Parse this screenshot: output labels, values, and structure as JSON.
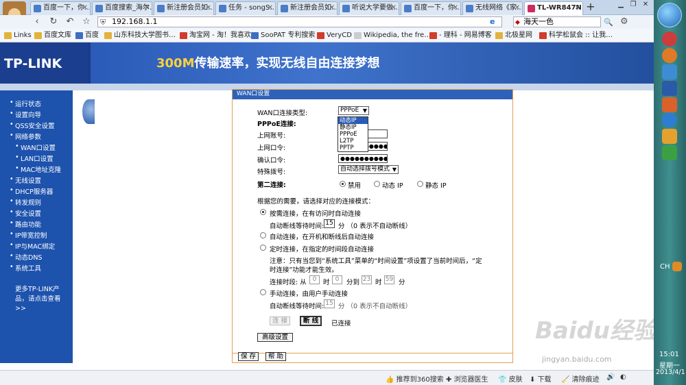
{
  "browser": {
    "tabs": [
      {
        "label": "百度一下，你…"
      },
      {
        "label": "百度搜索_海尔…"
      },
      {
        "label": "新注册会员如…"
      },
      {
        "label": "任务 - songS…"
      },
      {
        "label": "新注册会员如…"
      },
      {
        "label": "听说大学要做…"
      },
      {
        "label": "百度一下，你…"
      },
      {
        "label": "无线网络《家…"
      },
      {
        "label": "TL-WR847N"
      }
    ],
    "new_tab": "+",
    "url": "192.168.1.1",
    "search_value": "海天一色",
    "bookmarks": [
      "Links",
      "百度文库",
      "百度",
      "山东科技大学图书…",
      "淘宝网 - 淘！我喜欢",
      "SooPAT 专利搜索",
      "VeryCD",
      "Wikipedia, the fre…",
      "- 理科 - 网易博客",
      "北极星网",
      "科学松鼠会 :: 让我…"
    ]
  },
  "router": {
    "brand": "TP-LINK",
    "slogan_highlight": "300M",
    "slogan_rest": "传输速率，实现无线自由连接梦想",
    "menu": [
      {
        "label": "运行状态"
      },
      {
        "label": "设置向导"
      },
      {
        "label": "QSS安全设置"
      },
      {
        "label": "网络参数"
      },
      {
        "label": "WAN口设置"
      },
      {
        "label": "LAN口设置"
      },
      {
        "label": "MAC地址克隆"
      },
      {
        "label": "无线设置"
      },
      {
        "label": "DHCP服务器"
      },
      {
        "label": "转发规则"
      },
      {
        "label": "安全设置"
      },
      {
        "label": "路由功能"
      },
      {
        "label": "IP带宽控制"
      },
      {
        "label": "IP与MAC绑定"
      },
      {
        "label": "动态DNS"
      },
      {
        "label": "系统工具"
      }
    ],
    "more_link": "更多TP-LINK产品，请点击查看 >>",
    "panel": {
      "title": "WAN口设置",
      "conn_type_label": "WAN口连接类型:",
      "conn_type_value": "PPPoE",
      "dropdown_options": [
        "动态IP",
        "静态IP",
        "PPPoE",
        "L2TP",
        "PPTP"
      ],
      "pppoe_label": "PPPoE连接:",
      "account_label": "上网账号:",
      "password_label": "上网口令:",
      "confirm_label": "确认口令:",
      "password_mask": "●●●●●●●●●●●●",
      "special_dial_label": "特殊拨号:",
      "special_dial_value": "自动选择拨号模式",
      "second_conn_label": "第二连接:",
      "second_options": [
        "禁用",
        "动态 IP",
        "静态 IP"
      ],
      "mode_prompt": "根据您的需要，请选择对应的连接模式：",
      "mode_on_demand": "按需连接，在有访问时自动连接",
      "idle_label": "自动断线等待时间:",
      "idle_value": "15",
      "idle_unit": "分 （0 表示不自动断线）",
      "mode_auto": "自动连接，在开机和断线后自动连接",
      "mode_timed": "定时连接，在指定的时间段自动连接",
      "note_line1": "注意：只有当您到“系统工具”菜单的“时间设置”项设置了当前时间后，“定",
      "note_line2": "时连接”功能才能生效。",
      "period_label": "连接时段: 从",
      "t_from_h": "0",
      "t_h1": "时",
      "t_from_m": "0",
      "t_to": "分到",
      "t_to_h": "23",
      "t_h2": "时",
      "t_to_m": "59",
      "t_m2": "分",
      "mode_manual": "手动连接，由用户手动连接",
      "idle_value2": "15",
      "connect_btn": "连 接",
      "disconnect_btn": "断 线",
      "status": "已连接",
      "advanced_btn": "高级设置",
      "save_btn": "保 存",
      "help_btn": "帮 助"
    }
  },
  "statusbar": {
    "recommend": "推荐到360搜索",
    "doctor": "浏览器医生",
    "skin": "皮肤",
    "download": "下载",
    "clear": "清除痕迹"
  },
  "taskbar": {
    "lang": "CH",
    "time": "15:01",
    "day": "星期一",
    "date": "2013/4/1"
  },
  "watermark": {
    "main": "Baidu经验",
    "sub": "jingyan.baidu.com"
  }
}
